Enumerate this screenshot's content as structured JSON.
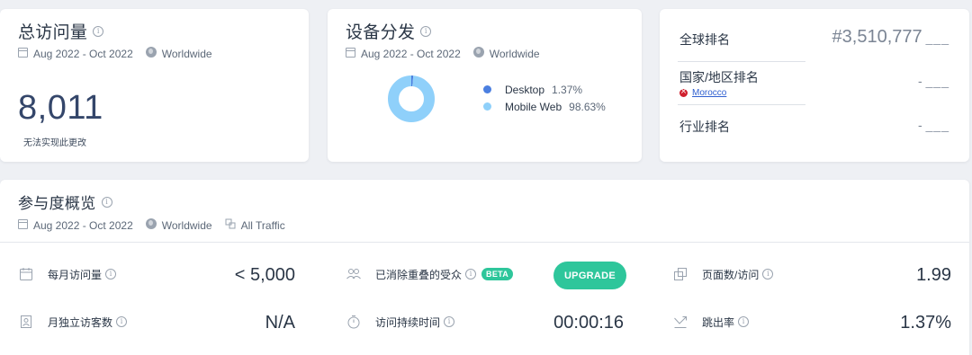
{
  "visits_card": {
    "title": "总访问量",
    "date_range": "Aug 2022 - Oct 2022",
    "region": "Worldwide",
    "value": "8,011",
    "note": "无法实现此更改"
  },
  "devices_card": {
    "title": "设备分发",
    "date_range": "Aug 2022 - Oct 2022",
    "region": "Worldwide",
    "legend": [
      {
        "label": "Desktop",
        "value": "1.37%",
        "color": "#4b7fe0"
      },
      {
        "label": "Mobile Web",
        "value": "98.63%",
        "color": "#8fd0fa"
      }
    ]
  },
  "chart_data": {
    "type": "pie",
    "title": "",
    "categories": [
      "Desktop",
      "Mobile Web"
    ],
    "values": [
      1.37,
      98.63
    ],
    "colors": [
      "#4b7fe0",
      "#8fd0fa"
    ],
    "donut": true
  },
  "rank_card": {
    "global_label": "全球排名",
    "global_value": "#3,510,777",
    "global_dash": "___",
    "country_label": "国家/地区排名",
    "country_name": "Morocco",
    "country_value": "-",
    "country_dash": "___",
    "industry_label": "行业排名",
    "industry_value": "-",
    "industry_dash": "___"
  },
  "engagement": {
    "title": "参与度概览",
    "date_range": "Aug 2022 - Oct 2022",
    "region": "Worldwide",
    "traffic": "All Traffic",
    "monthly_visits_label": "每月访问量",
    "monthly_visits_value": "< 5,000",
    "unique_visitors_label": "月独立访客数",
    "unique_visitors_value": "N/A",
    "dedup_audience_label": "已消除重叠的受众",
    "beta_label": "BETA",
    "upgrade_label": "UPGRADE",
    "duration_label": "访问持续时间",
    "duration_value": "00:00:16",
    "pages_per_visit_label": "页面数/访问",
    "pages_per_visit_value": "1.99",
    "bounce_rate_label": "跳出率",
    "bounce_rate_value": "1.37%"
  },
  "colors": {
    "accent_green": "#2ec69b",
    "big_number": "#34466a",
    "desktop": "#4b7fe0",
    "mobile": "#8fd0fa",
    "flag_red": "#d0202e",
    "link_blue": "#2f5fd0"
  }
}
